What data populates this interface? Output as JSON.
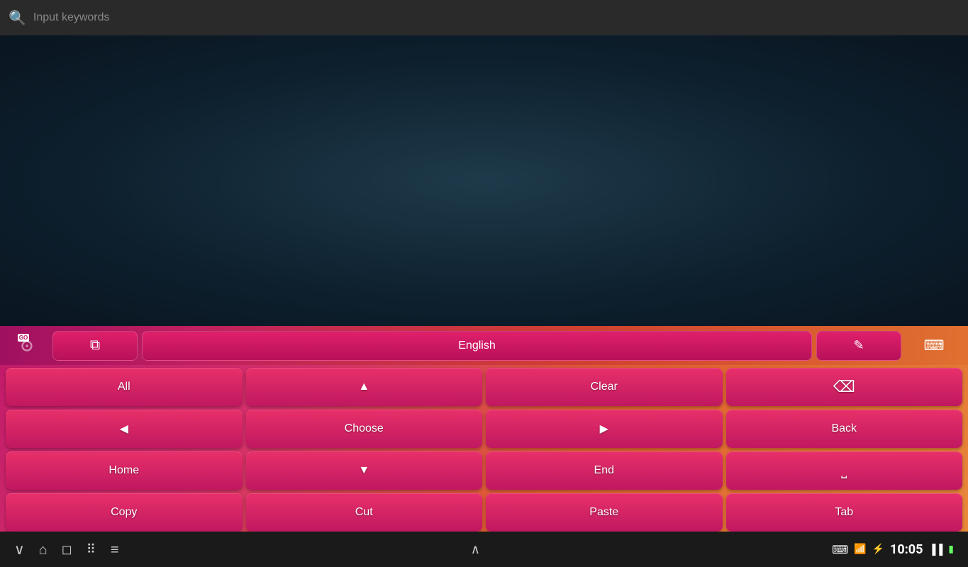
{
  "search": {
    "placeholder": "Input keywords"
  },
  "toolbar": {
    "go_label": "GO",
    "clipboard_icon": "⧉",
    "english_label": "English",
    "edit_icon": "✏",
    "keyboard_icon": "⌨"
  },
  "keys": {
    "row1": [
      {
        "id": "all",
        "label": "All"
      },
      {
        "id": "up",
        "label": "▲"
      },
      {
        "id": "clear",
        "label": "Clear"
      },
      {
        "id": "backspace",
        "label": "⌫"
      }
    ],
    "row2": [
      {
        "id": "left",
        "label": "◀"
      },
      {
        "id": "choose",
        "label": "Choose"
      },
      {
        "id": "right",
        "label": "▶"
      },
      {
        "id": "back",
        "label": "Back"
      }
    ],
    "row3": [
      {
        "id": "home",
        "label": "Home"
      },
      {
        "id": "down",
        "label": "▼"
      },
      {
        "id": "end",
        "label": "End"
      },
      {
        "id": "space",
        "label": "⎵"
      }
    ],
    "row4": [
      {
        "id": "copy",
        "label": "Copy"
      },
      {
        "id": "cut",
        "label": "Cut"
      },
      {
        "id": "paste",
        "label": "Paste"
      },
      {
        "id": "tab",
        "label": "Tab"
      }
    ]
  },
  "statusbar": {
    "time": "10:05",
    "keyboard_icon": "⌨",
    "battery_icon": "▮",
    "signal_icon": "▮",
    "charging_icon": "⚡"
  },
  "nav": {
    "back": "∨",
    "home": "⌂",
    "recents": "◻",
    "grid": "⠿",
    "menu": "≡",
    "up_chevron": "∧"
  }
}
